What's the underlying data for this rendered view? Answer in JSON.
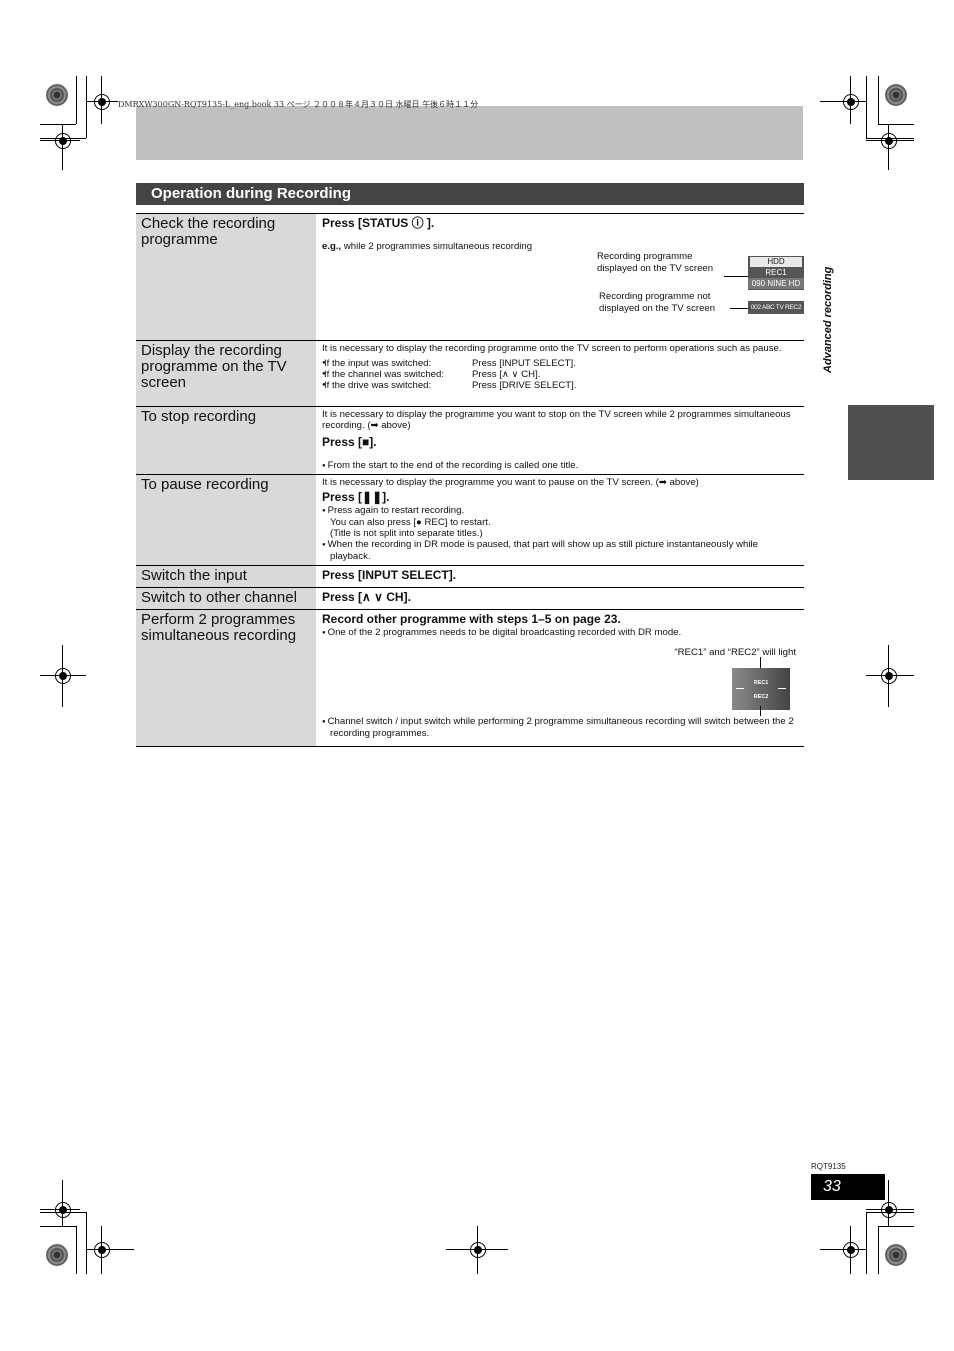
{
  "print_info": {
    "book_line": "DMRXW300GN-RQT9135-L_eng.book  33 ページ  ２００８年４月３０日  水曜日  午後６時１１分"
  },
  "section": {
    "title": "Operation during Recording"
  },
  "side_tab": {
    "label": "Advanced recording"
  },
  "rows": [
    {
      "label": "Check the recording programme",
      "press": "Press [STATUS ⓘ ].",
      "example_bold": "e.g.,",
      "example_text": " while 2 programmes simultaneous recording",
      "callout_displayed": "Recording programme displayed on the TV screen",
      "callout_not_displayed": "Recording programme not displayed on the TV screen",
      "tv_panel": {
        "line1": "HDD",
        "line2": "REC1",
        "line3": "090 NINE HD"
      },
      "tv_panel_2": "002 ABC TV REC2"
    },
    {
      "label": "Display the recording programme on the TV screen",
      "intro": "It is necessary to display the recording programme onto the TV screen to perform operations such as pause.",
      "items": [
        {
          "condition": "If the input was switched:",
          "action": "Press [INPUT SELECT]."
        },
        {
          "condition": "If the channel was switched:",
          "action": "Press [∧ ∨ CH]."
        },
        {
          "condition": "If the drive was switched:",
          "action": "Press [DRIVE SELECT]."
        }
      ]
    },
    {
      "label": "To stop recording",
      "intro": "It is necessary to display the programme you want to stop on the TV screen while 2 programmes simultaneous recording. (➡ above)",
      "press": "Press [■].",
      "note": "From the start to the end of the recording is called one title."
    },
    {
      "label": "To pause recording",
      "intro": "It is necessary to display the programme you want to pause on the TV screen. (➡ above)",
      "press": "Press [❚❚].",
      "note1_line1": "Press again to restart recording.",
      "note1_line2": "You can also press [● REC] to restart.",
      "note1_line3": "(Title is not split into separate titles.)",
      "note2": "When the recording in DR mode is paused, that part will show up as still picture instantaneously while playback."
    },
    {
      "label": "Switch the input",
      "press": "Press [INPUT SELECT]."
    },
    {
      "label": "Switch to other channel",
      "press": "Press [∧ ∨ CH]."
    },
    {
      "label": "Perform 2 programmes simultaneous recording",
      "press": "Record other programme with steps 1–5 on page 23.",
      "note1": "One of the 2 programmes needs to be digital broadcasting recorded with DR mode.",
      "callout": "“REC1” and “REC2” will light",
      "panel_rec1": "REC1",
      "panel_rec2": "REC2",
      "note2": "Channel switch / input switch while performing 2 programme simultaneous recording will switch between the 2 recording programmes."
    }
  ],
  "footer": {
    "model": "RQT9135",
    "page_number": "33"
  }
}
